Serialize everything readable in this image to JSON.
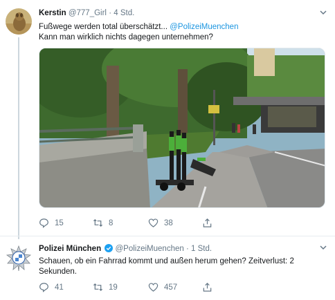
{
  "tweet1": {
    "name": "Kerstin",
    "handle": "@777_Girl",
    "separator": "·",
    "time": "4 Std.",
    "text_line1_prefix": "Fußwege werden total überschätzt... ",
    "mention": "@PolizeiMuenchen",
    "text_line2": "Kann man wirklich nichts dagegen unternehmen?",
    "image_icon": "photo-scooters-on-sidewalk",
    "actions": {
      "reply_count": "15",
      "retweet_count": "8",
      "like_count": "38"
    }
  },
  "tweet2": {
    "name": "Polizei München",
    "handle": "@PolizeiMuenchen",
    "separator": "·",
    "time": "1 Std.",
    "text_line1": "Schauen, ob ein Fahrrad kommt und außen herum gehen? Zeitverlust: 2",
    "text_line2": "Sekunden.",
    "actions": {
      "reply_count": "41",
      "retweet_count": "19",
      "like_count": "457"
    }
  },
  "colors": {
    "text": "#14171a",
    "secondary": "#657786",
    "link": "#1b95e0",
    "verified": "#1da1f2",
    "divider": "#e6ecf0"
  }
}
